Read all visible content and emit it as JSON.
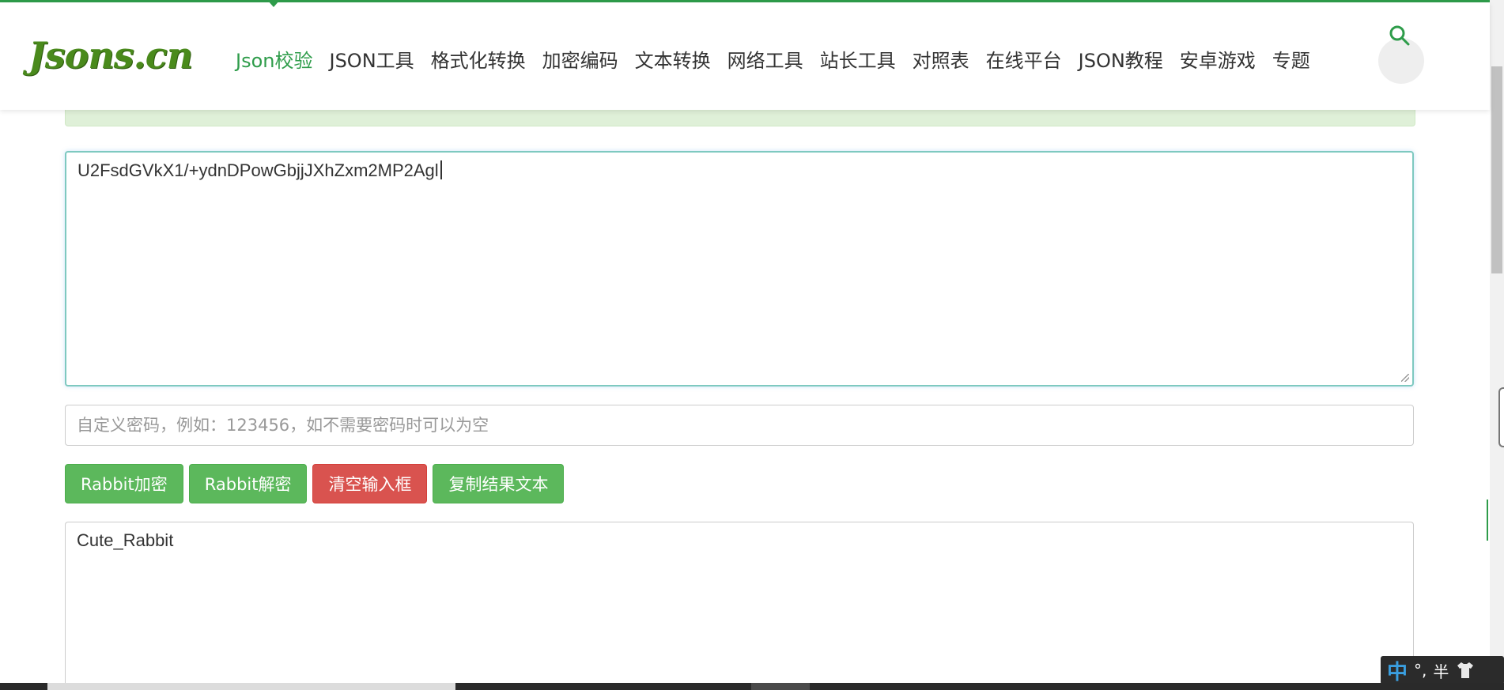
{
  "site": {
    "logo": "Jsons.cn"
  },
  "nav": {
    "items": [
      {
        "label": "Json校验",
        "active": true
      },
      {
        "label": "JSON工具",
        "active": false
      },
      {
        "label": "格式化转换",
        "active": false
      },
      {
        "label": "加密编码",
        "active": false
      },
      {
        "label": "文本转换",
        "active": false
      },
      {
        "label": "网络工具",
        "active": false
      },
      {
        "label": "站长工具",
        "active": false
      },
      {
        "label": "对照表",
        "active": false
      },
      {
        "label": "在线平台",
        "active": false
      },
      {
        "label": "JSON教程",
        "active": false
      },
      {
        "label": "安卓游戏",
        "active": false
      },
      {
        "label": "专题",
        "active": false
      }
    ],
    "search_icon": "search-icon"
  },
  "editor": {
    "input_value": "U2FsdGVkX1/+ydnDPowGbjjJXhZxm2MP2Agl",
    "password_placeholder": "自定义密码，例如：123456，如不需要密码时可以为空",
    "password_value": ""
  },
  "actions": {
    "encrypt_label": "Rabbit加密",
    "decrypt_label": "Rabbit解密",
    "clear_label": "清空输入框",
    "copy_label": "复制结果文本"
  },
  "result": {
    "text": "Cute_Rabbit"
  },
  "ime": {
    "mode": "中",
    "punct": "°,",
    "width": "半"
  },
  "colors": {
    "brand_green": "#2e9c4a",
    "button_green": "#5cb85c",
    "button_red": "#d9534f",
    "logo_green": "#4a8a1c"
  }
}
